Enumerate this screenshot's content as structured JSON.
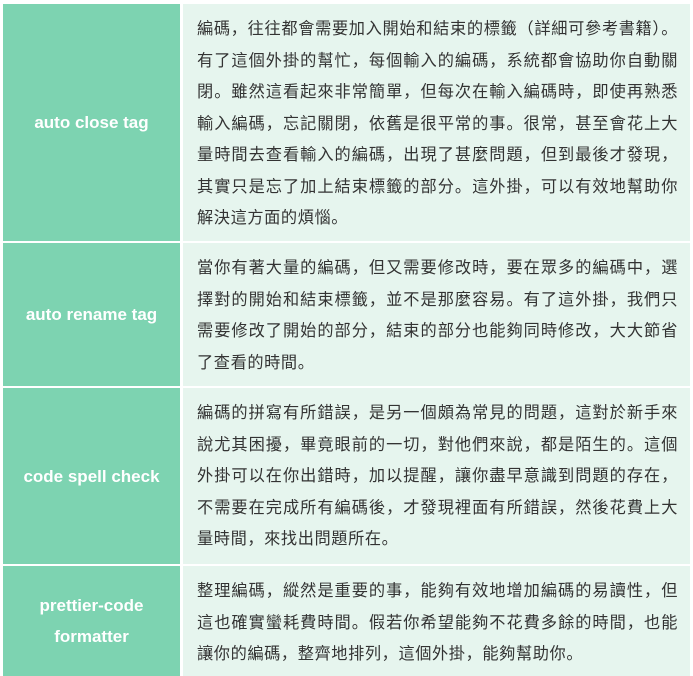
{
  "rows": [
    {
      "name": "auto close tag",
      "description": "編碼，往往都會需要加入開始和結束的標籤（詳細可參考書籍）。有了這個外掛的幫忙，每個輸入的編碼，系統都會協助你自動關閉。雖然這看起來非常簡單，但每次在輸入編碼時，即使再熟悉輸入編碼，忘記關閉，依舊是很平常的事。很常，甚至會花上大量時間去查看輸入的編碼，出現了甚麼問題，但到最後才發現，其實只是忘了加上結束標籤的部分。這外掛，可以有效地幫助你解決這方面的煩惱。"
    },
    {
      "name": "auto rename tag",
      "description": "當你有著大量的編碼，但又需要修改時，要在眾多的編碼中，選擇對的開始和結束標籤，並不是那麼容易。有了這外掛，我們只需要修改了開始的部分，結束的部分也能夠同時修改，大大節省了查看的時間。"
    },
    {
      "name": "code spell check",
      "description": "編碼的拼寫有所錯誤，是另一個頗為常見的問題，這對於新手來說尤其困擾，畢竟眼前的一切，對他們來說，都是陌生的。這個外掛可以在你出錯時，加以提醒，讓你盡早意識到問題的存在，不需要在完成所有編碼後，才發現裡面有所錯誤，然後花費上大量時間，來找出問題所在。"
    },
    {
      "name": "prettier-code formatter",
      "description": "整理編碼，縱然是重要的事，能夠有效地增加編碼的易讀性，但這也確實蠻耗費時間。假若你希望能夠不花費多餘的時間，也能讓你的編碼，整齊地排列，這個外掛，能夠幫助你。"
    }
  ]
}
